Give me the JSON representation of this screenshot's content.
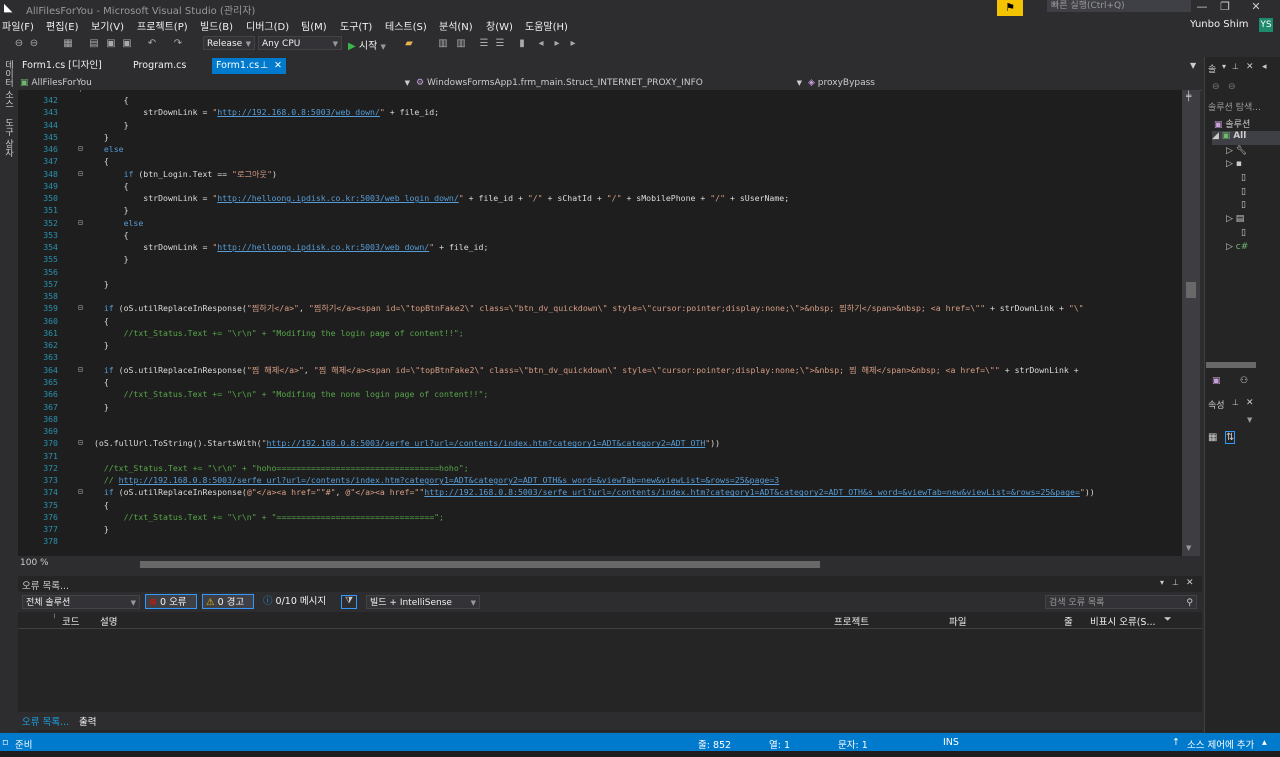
{
  "title": {
    "app": "AllFilesForYou - Microsoft Visual Studio  (관리자)",
    "quick_launch": "빠른 실행(Ctrl+Q)"
  },
  "menu": [
    "파일(F)",
    "편집(E)",
    "보기(V)",
    "프로젝트(P)",
    "빌드(B)",
    "디버그(D)",
    "팀(M)",
    "도구(T)",
    "테스트(S)",
    "분석(N)",
    "창(W)",
    "도움말(H)"
  ],
  "user": {
    "name": "Yunbo Shim",
    "initials": "YS"
  },
  "toolbar": {
    "config": "Release",
    "platform": "Any CPU",
    "start": "시작"
  },
  "left_tabs": [
    "데이터 소스",
    "도구 상자"
  ],
  "doc_tabs": [
    {
      "label": "Form1.cs [디자인]"
    },
    {
      "label": "Program.cs"
    },
    {
      "label": "Form1.cs",
      "pin": "⊥",
      "close": "✕"
    }
  ],
  "nav": {
    "project": "AllFilesForYou",
    "type": "WindowsFormsApp1.frm_main.Struct_INTERNET_PROXY_INFO",
    "member": "proxyBypass"
  },
  "code_lines": [
    {
      "n": "342",
      "fold": "",
      "c": "      {"
    },
    {
      "n": "343",
      "fold": "",
      "c": "          strDownLink = \"http://192.168.0.8:5003/web_down/\" + file_id;"
    },
    {
      "n": "344",
      "fold": "",
      "c": "      }"
    },
    {
      "n": "345",
      "fold": "",
      "c": "  }"
    },
    {
      "n": "346",
      "fold": "⊟",
      "c": "  else"
    },
    {
      "n": "347",
      "fold": "",
      "c": "  {"
    },
    {
      "n": "348",
      "fold": "⊟",
      "c": "      if (btn_Login.Text == \"로그아웃\")"
    },
    {
      "n": "349",
      "fold": "",
      "c": "      {"
    },
    {
      "n": "350",
      "fold": "",
      "c": "          strDownLink = \"http://helloong.ipdisk.co.kr:5003/web_login_down/\" + file_id + \"/\" + sChatId + \"/\" + sMobilePhone + \"/\" + sUserName;"
    },
    {
      "n": "351",
      "fold": "",
      "c": "      }"
    },
    {
      "n": "352",
      "fold": "⊟",
      "c": "      else"
    },
    {
      "n": "353",
      "fold": "",
      "c": "      {"
    },
    {
      "n": "354",
      "fold": "",
      "c": "          strDownLink = \"http://helloong.ipdisk.co.kr:5003/web_down/\" + file_id;"
    },
    {
      "n": "355",
      "fold": "",
      "c": "      }"
    },
    {
      "n": "356",
      "fold": "",
      "c": ""
    },
    {
      "n": "357",
      "fold": "",
      "c": "  }"
    },
    {
      "n": "358",
      "fold": "",
      "c": ""
    },
    {
      "n": "359",
      "fold": "⊟",
      "c": "  if (oS.utilReplaceInResponse(\"찜하기</a>\", \"찜하기</a><span id=\\\"topBtnFake2\\\" class=\\\"btn_dv_quickdown\\\" style=\\\"cursor:pointer;display:none;\\\">&nbsp; 찜하기</span>&nbsp; <a href=\\\"\" + strDownLink + \"\\\""
    },
    {
      "n": "360",
      "fold": "",
      "c": "  {"
    },
    {
      "n": "361",
      "fold": "",
      "c": "      //txt_Status.Text += \"\\r\\n\" + \"Modifing the login page of content!!\";"
    },
    {
      "n": "362",
      "fold": "",
      "c": "  }"
    },
    {
      "n": "363",
      "fold": "",
      "c": ""
    },
    {
      "n": "364",
      "fold": "⊟",
      "c": "  if (oS.utilReplaceInResponse(\"찜 해제</a>\", \"찜 해제</a><span id=\\\"topBtnFake2\\\" class=\\\"btn_dv_quickdown\\\" style=\\\"cursor:pointer;display:none;\\\">&nbsp; 찜 해제</span>&nbsp; <a href=\\\"\" + strDownLink +"
    },
    {
      "n": "365",
      "fold": "",
      "c": "  {"
    },
    {
      "n": "366",
      "fold": "",
      "c": "      //txt_Status.Text += \"\\r\\n\" + \"Modifing the none login page of content!!\";"
    },
    {
      "n": "367",
      "fold": "",
      "c": "  }"
    },
    {
      "n": "368",
      "fold": "",
      "c": ""
    },
    {
      "n": "369",
      "fold": "",
      "c": ""
    },
    {
      "n": "370",
      "fold": "⊟",
      "c": "(oS.fullUrl.ToString().StartsWith(\"http://192.168.0.8:5003/serfe_url?url=/contents/index.htm?category1=ADT&category2=ADT_OTH\"))"
    },
    {
      "n": "371",
      "fold": "",
      "c": ""
    },
    {
      "n": "372",
      "fold": "",
      "c": "  //txt_Status.Text += \"\\r\\n\" + \"hoho=================================hoho\";"
    },
    {
      "n": "373",
      "fold": "",
      "c": "  // http://192.168.0.8:5003/serfe_url?url=/contents/index.htm?category1=ADT&category2=ADT_OTH&s_word=&viewTab=new&viewList=&rows=25&page=3"
    },
    {
      "n": "374",
      "fold": "⊟",
      "c": "  if (oS.utilReplaceInResponse(@\"</a><a href=\"\"#\", @\"</a><a href=\"\"http://192.168.0.8:5003/serfe_url?url=/contents/index.htm?category1=ADT&category2=ADT_OTH&s_word=&viewTab=new&viewList=&rows=25&page=\"))"
    },
    {
      "n": "375",
      "fold": "",
      "c": "  {"
    },
    {
      "n": "376",
      "fold": "",
      "c": "      //txt_Status.Text += \"\\r\\n\" + \"================================\";"
    },
    {
      "n": "377",
      "fold": "",
      "c": "  }"
    },
    {
      "n": "378",
      "fold": "",
      "c": ""
    }
  ],
  "zoom": "100 %",
  "error_panel": {
    "title": "오류 목록...",
    "scope": "전체 솔루션",
    "errors": "0 오류",
    "warnings": "0 경고",
    "messages": "0/10 메시지",
    "build_filter": "빌드 + IntelliSense",
    "search_placeholder": "검색 오류 목록",
    "columns": [
      "코드",
      "설명",
      "프로젝트",
      "파일",
      "줄",
      "비표시 오류(S..."
    ]
  },
  "bottom_tabs": [
    "오류 목록...",
    "출력"
  ],
  "status": {
    "ready": "준비",
    "line": "줄: 852",
    "col": "열: 1",
    "char": "문자: 1",
    "mode": "INS",
    "source_control": "소스 제어에 추가"
  },
  "solution_explorer": {
    "title": "솔루션 탐색...",
    "root": "솔루션",
    "project": "All"
  },
  "properties": {
    "title": "속성"
  },
  "colors": {
    "accent": "#007acc",
    "editor_bg": "#1e1e1e",
    "chrome_bg": "#2d2d30",
    "keyword": "#569cd6",
    "string": "#d69d85",
    "comment": "#57a64a",
    "line_number": "#2b91af"
  }
}
